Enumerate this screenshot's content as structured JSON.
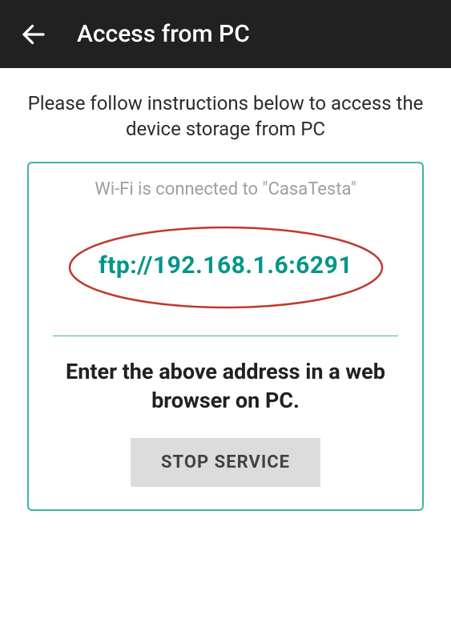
{
  "header": {
    "title": "Access from PC"
  },
  "instructions": "Please follow instructions below to access the device storage from PC",
  "wifi_status": "Wi-Fi is connected to \"CasaTesta\"",
  "ftp_address": "ftp://192.168.1.6:6291",
  "enter_text": "Enter the above address in a web browser on PC.",
  "stop_button_label": "STOP SERVICE"
}
